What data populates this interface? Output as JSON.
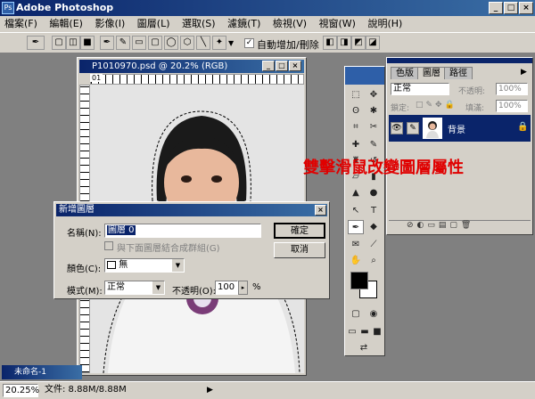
{
  "app": {
    "title": "Adobe Photoshop"
  },
  "menu": {
    "items": [
      "檔案(F)",
      "編輯(E)",
      "影像(I)",
      "圖層(L)",
      "選取(S)",
      "濾鏡(T)",
      "檢視(V)",
      "視窗(W)",
      "說明(H)"
    ]
  },
  "options_bar": {
    "auto_add_label": "自動增加/刪除"
  },
  "document": {
    "title": "P1010970.psd @ 20.2% (RGB)",
    "ruler_tag": "01"
  },
  "dialog": {
    "title": "新增圖層",
    "name_label": "名稱(N):",
    "name_value": "圖層 0",
    "group_label": "與下面圖層結合成群組(G)",
    "color_label": "顏色(C):",
    "color_value": "無",
    "mode_label": "模式(M):",
    "mode_value": "正常",
    "opacity_label": "不透明(O):",
    "opacity_value": "100",
    "opacity_unit": "%",
    "ok_label": "確定",
    "cancel_label": "取消"
  },
  "layers_panel": {
    "tabs": [
      "色版",
      "圖層",
      "路徑"
    ],
    "blend_mode": "正常",
    "opacity_label": "不透明:",
    "opacity_value": "100%",
    "lock_label": "鎖定:",
    "fill_label": "填滿:",
    "fill_value": "100%",
    "layer_name": "背景"
  },
  "annotation": "雙擊滑鼠改變圖層屬性",
  "status": {
    "zoom": "20.25%",
    "doc_size": "文件: 8.88M/8.88M"
  },
  "taskbar_doc": "未命名-1",
  "colors": {
    "title_dark": "#0a246a",
    "title_light": "#3a6ea5",
    "annotation": "#e00000",
    "chrome": "#d4d0c8",
    "selected_layer": "#0a246a"
  }
}
